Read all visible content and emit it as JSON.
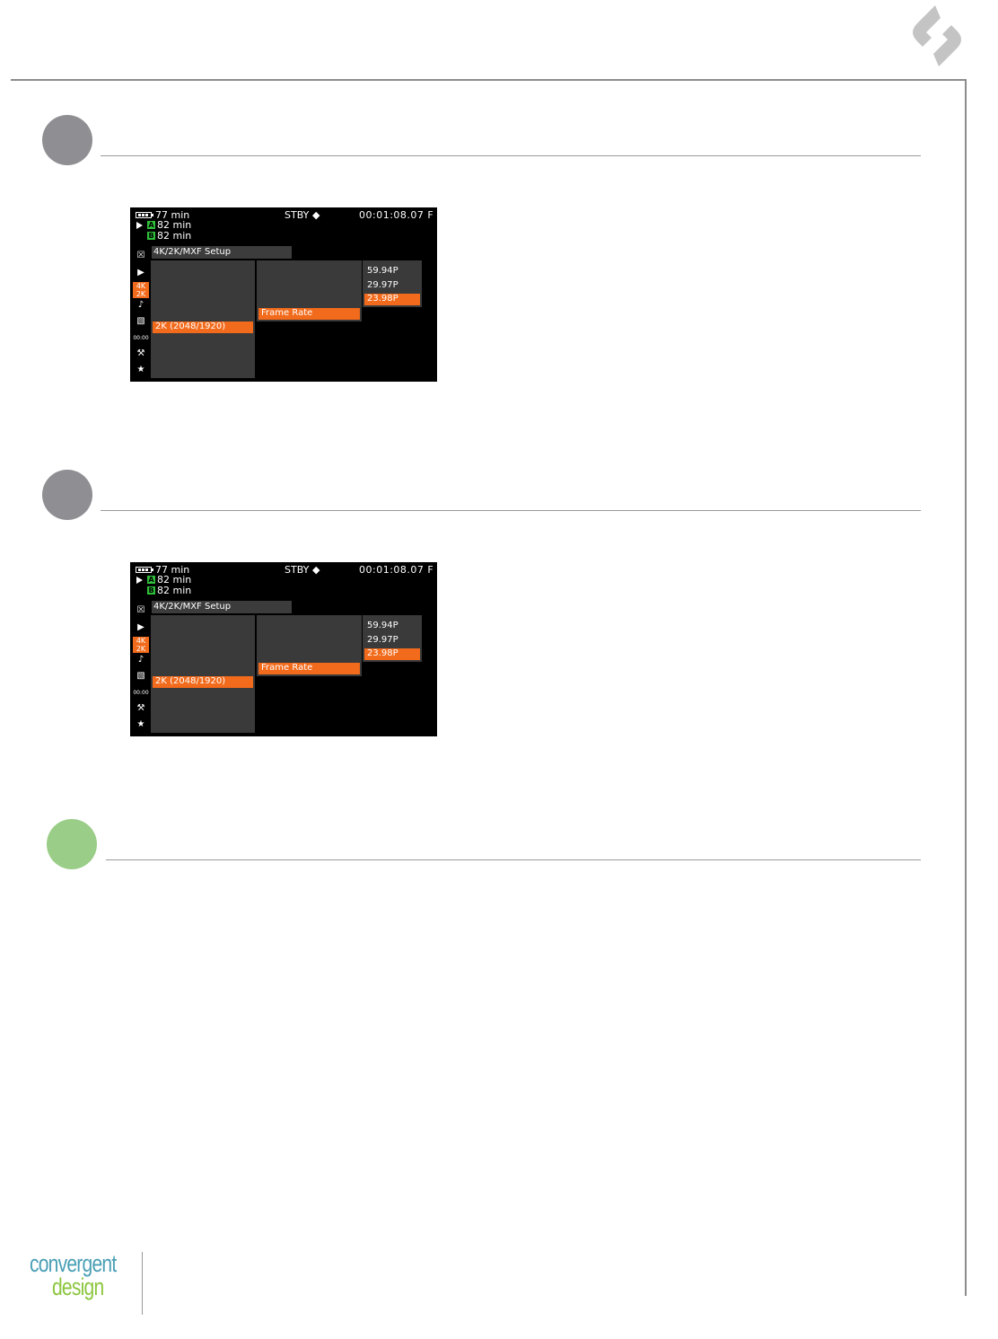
{
  "brand": {
    "logo_line1": "convergent",
    "logo_line2": "design",
    "colors": {
      "teal": "#4a9fb5",
      "green": "#8cc63f",
      "gray_logo": "#bfbfbf"
    }
  },
  "steps": [
    {
      "circle_color": "#8e8e93"
    },
    {
      "circle_color": "#8e8e93"
    },
    {
      "circle_color": "#9acd87"
    }
  ],
  "screens": [
    {
      "battery_time": "77 min",
      "slot_a_label": "A",
      "slot_a_time": "82 min",
      "slot_b_label": "B",
      "slot_b_time": "82 min",
      "status": "STBY",
      "timecode": "00:01:08.07 F",
      "menu_title": "4K/2K/MXF Setup",
      "side_icons": [
        "close-icon",
        "camera-icon",
        "4k-2k-icon",
        "audio-icon",
        "display-icon",
        "timecode-icon",
        "wrench-icon",
        "star-icon"
      ],
      "side_4k_label": "4K 2K",
      "side_timecode_label": "00:00",
      "column1_selected": "2K (2048/1920)",
      "column2_selected": "Frame Rate",
      "column3_options": [
        "59.94P",
        "29.97P",
        "23.98P"
      ],
      "column3_selected_index": 2
    },
    {
      "battery_time": "77 min",
      "slot_a_label": "A",
      "slot_a_time": "82 min",
      "slot_b_label": "B",
      "slot_b_time": "82 min",
      "status": "STBY",
      "timecode": "00:01:08.07 F",
      "menu_title": "4K/2K/MXF Setup",
      "side_icons": [
        "close-icon",
        "camera-icon",
        "4k-2k-icon",
        "audio-icon",
        "display-icon",
        "timecode-icon",
        "wrench-icon",
        "star-icon"
      ],
      "side_4k_label": "4K 2K",
      "side_timecode_label": "00:00",
      "column1_selected": "2K (2048/1920)",
      "column2_selected": "Frame Rate",
      "column3_options": [
        "59.94P",
        "29.97P",
        "23.98P"
      ],
      "column3_selected_index": 2
    }
  ]
}
